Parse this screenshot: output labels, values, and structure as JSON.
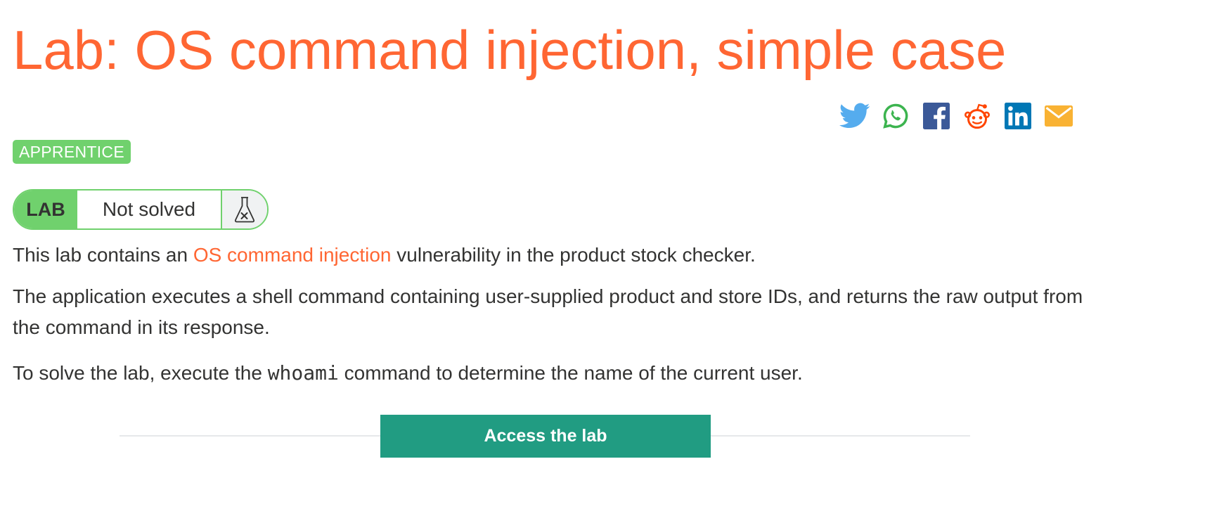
{
  "title": "Lab: OS command injection, simple case",
  "share": {
    "icons": [
      "twitter-icon",
      "whatsapp-icon",
      "facebook-icon",
      "reddit-icon",
      "linkedin-icon",
      "email-icon"
    ],
    "colors": {
      "twitter": "#55acee",
      "whatsapp": "#3cb44f",
      "facebook": "#3b5998",
      "reddit": "#ff4500",
      "linkedin": "#0077b5",
      "email": "#f9b233"
    }
  },
  "level_badge": "APPRENTICE",
  "lab_status": {
    "tag": "LAB",
    "status": "Not solved",
    "icon": "flask-x-icon"
  },
  "description": {
    "p1_before": "This lab contains an ",
    "p1_link": "OS command injection",
    "p1_after": " vulnerability in the product stock checker.",
    "p2": "The application executes a shell command containing user-supplied product and store IDs, and returns the raw output from the command in its response.",
    "p3_before": "To solve the lab, execute the ",
    "p3_code": "whoami",
    "p3_after": " command to determine the name of the current user."
  },
  "access_button": "Access the lab",
  "colors": {
    "accent": "#ff6633",
    "badge_green": "#70d16d",
    "button_teal": "#219c82",
    "text": "#333332"
  }
}
